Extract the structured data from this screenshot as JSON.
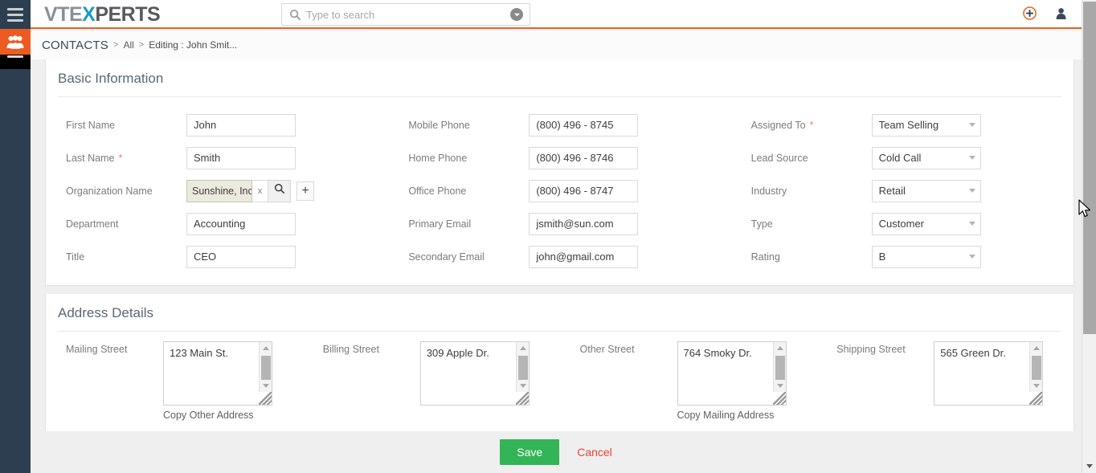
{
  "app": {
    "logo_vte": "VTE",
    "logo_x": "X",
    "logo_perts": "PERTS",
    "accent_color": "#e8622a",
    "sidebar_color": "#2c3e50"
  },
  "search": {
    "placeholder": "Type to search",
    "value": "",
    "icon": "search-icon",
    "caret_icon": "chevron-down-circle-icon"
  },
  "topbar": {
    "menu_icon": "hamburger-menu-icon",
    "module_icon": "contacts-group-icon",
    "quick_create_icon": "plus-circle-icon",
    "user_icon": "user-avatar-icon"
  },
  "breadcrumb": {
    "root": "CONTACTS",
    "separator": ">",
    "items": [
      "All"
    ],
    "current": "Editing : John Smit..."
  },
  "basic_information": {
    "title": "Basic Information",
    "columns": [
      {
        "fields": [
          {
            "label": "First Name",
            "required": false,
            "type": "text",
            "value": "John"
          },
          {
            "label": "Last Name",
            "required": true,
            "type": "text",
            "value": "Smith"
          },
          {
            "label": "Organization Name",
            "required": false,
            "type": "lookup",
            "value": "Sunshine, Inc",
            "clear_label": "x",
            "search_icon": "search-icon",
            "add_label": "+"
          },
          {
            "label": "Department",
            "required": false,
            "type": "text",
            "value": "Accounting"
          },
          {
            "label": "Title",
            "required": false,
            "type": "text",
            "value": "CEO"
          }
        ]
      },
      {
        "fields": [
          {
            "label": "Mobile Phone",
            "required": false,
            "type": "text",
            "value": "(800) 496 - 8745"
          },
          {
            "label": "Home Phone",
            "required": false,
            "type": "text",
            "value": "(800) 496 - 8746"
          },
          {
            "label": "Office Phone",
            "required": false,
            "type": "text",
            "value": "(800) 496 - 8747"
          },
          {
            "label": "Primary Email",
            "required": false,
            "type": "text",
            "value": "jsmith@sun.com"
          },
          {
            "label": "Secondary Email",
            "required": false,
            "type": "text",
            "value": "john@gmail.com"
          }
        ]
      },
      {
        "fields": [
          {
            "label": "Assigned To",
            "required": true,
            "type": "select",
            "value": "Team Selling"
          },
          {
            "label": "Lead Source",
            "required": false,
            "type": "select",
            "value": "Cold Call"
          },
          {
            "label": "Industry",
            "required": false,
            "type": "select",
            "value": "Retail"
          },
          {
            "label": "Type",
            "required": false,
            "type": "select",
            "value": "Customer"
          },
          {
            "label": "Rating",
            "required": false,
            "type": "select",
            "value": "B"
          }
        ]
      }
    ]
  },
  "address_details": {
    "title": "Address Details",
    "fields": [
      {
        "label": "Mailing Street",
        "value": "123 Main St.",
        "copy_link": "Copy Other Address"
      },
      {
        "label": "Billing Street",
        "value": "309 Apple Dr.",
        "copy_link": ""
      },
      {
        "label": "Other Street",
        "value": "764 Smoky Dr.",
        "copy_link": "Copy Mailing Address"
      },
      {
        "label": "Shipping Street",
        "value": "565 Green Dr.",
        "copy_link": ""
      }
    ]
  },
  "footer": {
    "save_label": "Save",
    "cancel_label": "Cancel",
    "save_color": "#33b457",
    "cancel_color": "#ef4136"
  },
  "scrollbar": {
    "down_arrow_icon": "chevron-down-icon"
  }
}
